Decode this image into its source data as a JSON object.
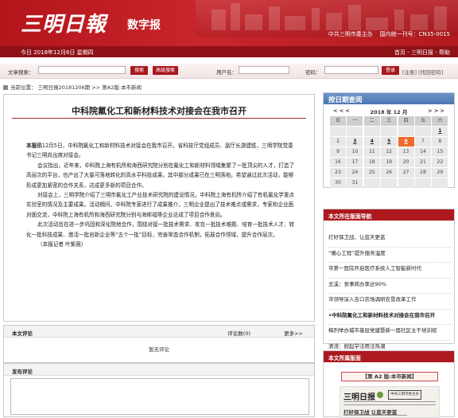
{
  "masthead": {
    "logo_cn": "三明日報",
    "logo_sub": "数字报",
    "publisher": "中共三明市委主办",
    "cn_number": "国内统一刊号：CN35-0015",
    "date": "今日  2018年12月6日  星期四",
    "links": "首页 - 三明日报 - 帮助"
  },
  "search": {
    "label": "文章搜索：",
    "search_btn": "搜索",
    "advanced_btn": "高级搜索",
    "user_label": "用户名：",
    "pwd_label": "密码：",
    "login_btn": "登录",
    "reg_links": "[注册] [找回密码]"
  },
  "breadcrumb": "当前位置： 三明日报20181206期 >> 第A2版:本市新闻",
  "article": {
    "title": "中科院氟化工和新材料技术对接会在我市召开",
    "lead_bold": "本报讯",
    "paragraphs": [
      "12月5日，中科院氟化工和新材料技术对接会在我市召开。省科技厅党组成员、副厅长游建胜，三明学院党委书记三明尚出席对接会。",
      "会议指出，近年来，中科院上海有机所和海西研究院分别在氟化工和新材料领域集聚了一批顶尖的人才，打造了高层次的平台，也产出了大量可落地转化的高水平科技成果，其中部分成果已在三明落地。希望通过此次活动，能够形成更加紧密的合作关系，达成更多新的项目合作。",
      "对接会上，三明学院介绍了三明市氟化工产业技术研究院的建设情况，中科院上海有机所介绍了有机氟化学重点实验室的情况及主要成果。活动期间，中科院专家进行了成果推介，三明企业提出了技术难点或需求，专家和企业面对面交流，中科院上海有机所和海西研究院分别与海斯福等企业达成了项目合作意向。",
      "此次活动旨在进一步巩固和深化院地合作，围绕对接一批技术需求、攻克一批技术难题、培育一批技术人才、转化一批科技成果、激活一批创新企业等“五个一批”目标，完善常态合作机制，拓展合作领域，提升合作层次。"
    ],
    "reporter": "（本报记者 叶紫薇）"
  },
  "comment": {
    "title": "本文评论",
    "count": "评论数(0)",
    "more": "更多>>",
    "empty": "暂无评论"
  },
  "post": {
    "title": "发布评论"
  },
  "calendar": {
    "title": "按日期查阅",
    "prev": "< < <",
    "month": "2018 年 12 月",
    "next": "> > >",
    "weekdays": [
      "日",
      "一",
      "二",
      "三",
      "四",
      "五",
      "六"
    ],
    "weeks": [
      [
        "",
        "",
        "",
        "",
        "",
        "",
        "1"
      ],
      [
        "2",
        "3",
        "4",
        "5",
        "6",
        "7",
        "8"
      ],
      [
        "9",
        "10",
        "11",
        "12",
        "13",
        "14",
        "15"
      ],
      [
        "16",
        "17",
        "18",
        "19",
        "20",
        "21",
        "22"
      ],
      [
        "23",
        "24",
        "25",
        "26",
        "27",
        "28",
        "29"
      ],
      [
        "30",
        "31",
        "",
        "",
        "",
        "",
        ""
      ]
    ],
    "today": "6",
    "linked": [
      "1",
      "3",
      "4",
      "5",
      "6"
    ]
  },
  "version_nav": {
    "title": "本文所在版面导航",
    "items": [
      "打好保卫战、让蓝天更蓝",
      "“暖心工程”提升服务温度",
      "市第一医院开启医疗系统人工智能新时代",
      "尤溪：丧事简办率达90%",
      "市领导深入吉口农场调研农垦改革工作",
      "•中科院氟化工和新材料技术对接会在我市召开",
      "梅列举办城市基层党建暨新一届社区主干培训班",
      "清流：掀起学法用法热潮"
    ],
    "current": 5
  },
  "pdf": {
    "title": "本文所属版面",
    "label": "【第 A2 版:本市新闻】",
    "thumb_masthead": "三明日报",
    "thumb_stamp": "中共三明市委主办",
    "thumb_headline": "打好保卫战 让蓝天更蓝"
  }
}
